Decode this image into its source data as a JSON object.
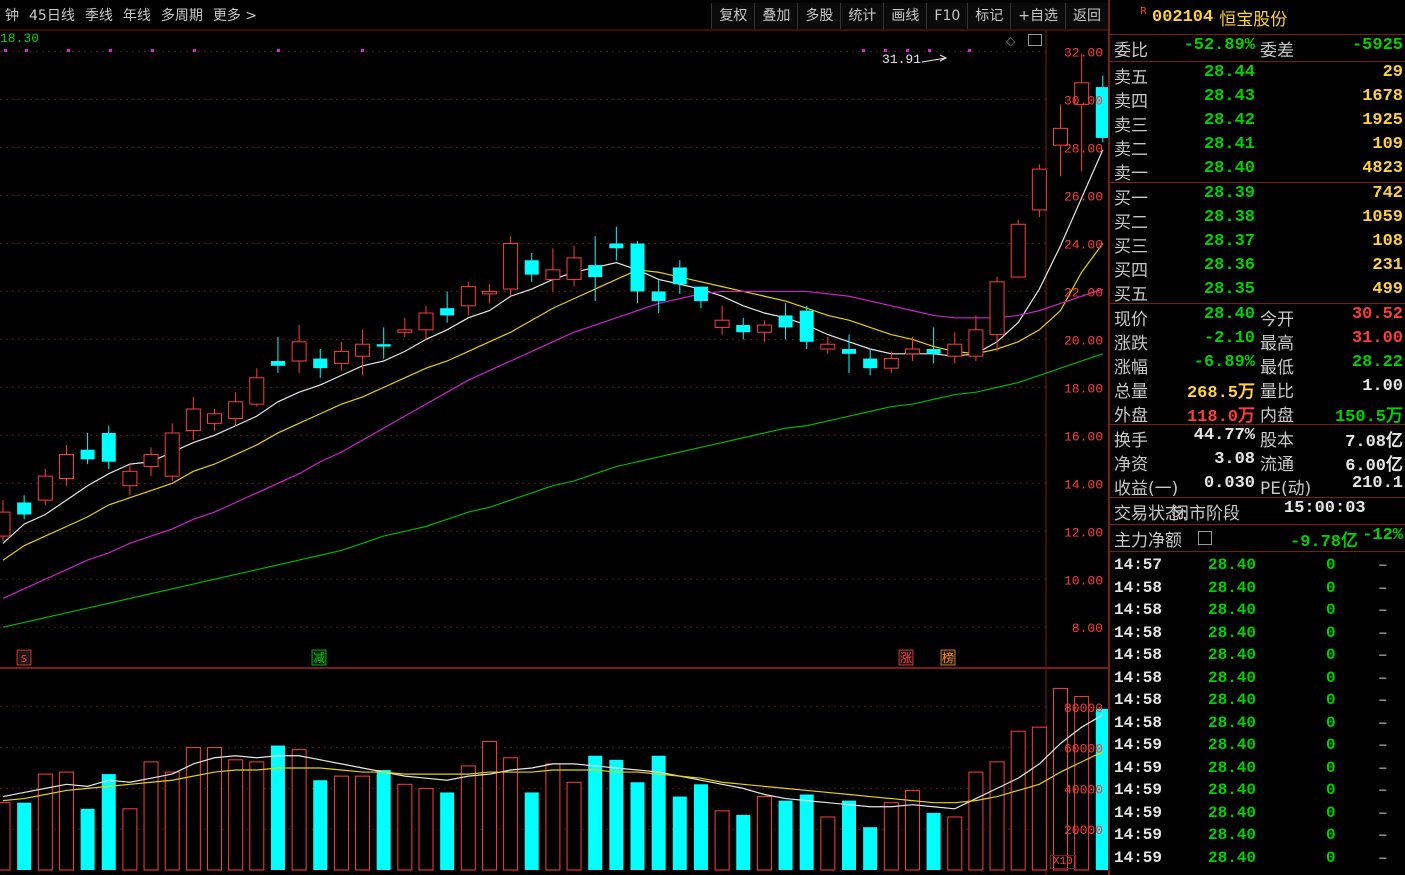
{
  "toolbar": {
    "left": [
      "钟",
      "45日线",
      "季线",
      "年线",
      "多周期",
      "更多 >"
    ],
    "right": [
      "复权",
      "叠加",
      "多股",
      "统计",
      "画线",
      "F10",
      "标记",
      "+自选",
      "返回"
    ]
  },
  "chart": {
    "prev_close_label": "18.30",
    "high_marker": "31.91",
    "price_axis": [
      "32.00",
      "30.00",
      "28.00",
      "26.00",
      "24.00",
      "22.00",
      "20.00",
      "18.00",
      "16.00",
      "14.00",
      "12.00",
      "10.00",
      "8.00"
    ],
    "volume_axis": [
      "80000",
      "60000",
      "40000",
      "20000"
    ],
    "volume_unit": "X10",
    "event_tags": [
      {
        "text": "s",
        "color": "#ff3c3c"
      },
      {
        "text": "减",
        "color": "#00d200"
      },
      {
        "text": "涨",
        "color": "#ff3c3c"
      },
      {
        "text": "榜",
        "color": "#ff8c1a"
      }
    ]
  },
  "chart_data": {
    "type": "candlestick",
    "ylim": [
      6.3,
      32.9
    ],
    "candles": [
      [
        11.8,
        12.8,
        13.3,
        11.6
      ],
      [
        13.2,
        12.7,
        13.5,
        12.5
      ],
      [
        13.3,
        14.3,
        14.6,
        13.1
      ],
      [
        14.2,
        15.2,
        15.6,
        13.9
      ],
      [
        15.4,
        15.0,
        16.1,
        14.8
      ],
      [
        16.1,
        14.9,
        16.4,
        14.6
      ],
      [
        13.9,
        14.5,
        14.8,
        13.5
      ],
      [
        14.7,
        15.2,
        15.5,
        14.3
      ],
      [
        14.3,
        16.1,
        16.5,
        14.1
      ],
      [
        16.2,
        17.1,
        17.6,
        15.8
      ],
      [
        16.5,
        16.9,
        17.1,
        16.2
      ],
      [
        16.7,
        17.4,
        17.8,
        16.4
      ],
      [
        17.3,
        18.4,
        18.8,
        17.2
      ],
      [
        19.1,
        18.9,
        20.1,
        18.6
      ],
      [
        19.1,
        19.9,
        20.6,
        18.6
      ],
      [
        19.2,
        18.8,
        19.6,
        18.4
      ],
      [
        19.0,
        19.5,
        19.9,
        18.7
      ],
      [
        19.3,
        19.8,
        20.4,
        18.5
      ],
      [
        19.8,
        19.7,
        20.5,
        19.2
      ],
      [
        20.3,
        20.4,
        20.9,
        20.1
      ],
      [
        20.4,
        21.1,
        21.4,
        20.0
      ],
      [
        21.3,
        21.0,
        22.0,
        20.7
      ],
      [
        21.4,
        22.2,
        22.4,
        21.0
      ],
      [
        21.9,
        22.0,
        22.3,
        21.5
      ],
      [
        22.1,
        24.0,
        24.3,
        21.8
      ],
      [
        23.3,
        22.7,
        23.6,
        22.4
      ],
      [
        22.5,
        22.9,
        23.8,
        22.0
      ],
      [
        22.5,
        23.4,
        23.9,
        22.2
      ],
      [
        23.1,
        22.6,
        24.3,
        21.6
      ],
      [
        24.0,
        23.8,
        24.7,
        23.3
      ],
      [
        24.0,
        22.0,
        24.1,
        21.5
      ],
      [
        22.0,
        21.6,
        22.5,
        21.1
      ],
      [
        23.0,
        22.3,
        23.3,
        21.9
      ],
      [
        22.2,
        21.6,
        22.2,
        21.3
      ],
      [
        20.5,
        20.8,
        21.4,
        20.2
      ],
      [
        20.6,
        20.3,
        20.9,
        20.0
      ],
      [
        20.3,
        20.6,
        20.8,
        19.9
      ],
      [
        21.0,
        20.5,
        21.5,
        20.0
      ],
      [
        21.2,
        19.9,
        21.4,
        19.6
      ],
      [
        19.6,
        19.8,
        20.1,
        19.4
      ],
      [
        19.6,
        19.4,
        20.2,
        18.6
      ],
      [
        19.2,
        18.8,
        19.6,
        18.5
      ],
      [
        18.8,
        19.2,
        19.5,
        18.6
      ],
      [
        19.4,
        19.6,
        20.1,
        19.1
      ],
      [
        19.6,
        19.4,
        20.5,
        19.0
      ],
      [
        19.3,
        19.8,
        20.3,
        19.0
      ],
      [
        19.3,
        20.4,
        21.0,
        19.1
      ],
      [
        20.2,
        22.4,
        22.6,
        19.5
      ],
      [
        22.6,
        24.8,
        25.0,
        22.6
      ],
      [
        25.4,
        27.1,
        27.3,
        25.1
      ],
      [
        28.1,
        28.8,
        29.8,
        26.8
      ],
      [
        29.8,
        30.7,
        31.91,
        27.0
      ],
      [
        30.52,
        28.4,
        31.0,
        28.22
      ]
    ],
    "ma_white": [
      11.5,
      12.3,
      12.7,
      13.3,
      13.9,
      14.4,
      14.8,
      14.9,
      15.3,
      15.7,
      16.0,
      16.4,
      16.8,
      17.4,
      17.8,
      18.1,
      18.5,
      18.9,
      19.1,
      19.5,
      20.0,
      20.4,
      20.9,
      21.2,
      21.8,
      22.1,
      22.5,
      22.8,
      23.0,
      23.2,
      22.9,
      22.5,
      22.3,
      22.1,
      21.8,
      21.4,
      21.1,
      20.9,
      20.6,
      20.2,
      19.9,
      19.6,
      19.4,
      19.4,
      19.4,
      19.3,
      19.4,
      19.9,
      20.7,
      22.1,
      23.9,
      25.9,
      27.9
    ],
    "ma_yellow": [
      10.8,
      11.4,
      11.8,
      12.2,
      12.6,
      13.1,
      13.4,
      13.7,
      14.0,
      14.5,
      14.8,
      15.2,
      15.6,
      16.1,
      16.5,
      16.9,
      17.3,
      17.6,
      18.0,
      18.4,
      18.8,
      19.1,
      19.5,
      19.9,
      20.3,
      20.8,
      21.3,
      21.7,
      22.1,
      22.5,
      22.9,
      22.8,
      22.6,
      22.4,
      22.2,
      22.0,
      21.8,
      21.6,
      21.3,
      21.0,
      20.8,
      20.5,
      20.2,
      20.0,
      19.7,
      19.5,
      19.4,
      19.6,
      19.9,
      20.4,
      21.2,
      22.8,
      24.0
    ],
    "ma_magenta": [
      9.2,
      9.6,
      10.0,
      10.4,
      10.8,
      11.1,
      11.5,
      11.8,
      12.1,
      12.5,
      12.8,
      13.2,
      13.6,
      14.0,
      14.4,
      14.9,
      15.3,
      15.8,
      16.3,
      16.8,
      17.3,
      17.8,
      18.3,
      18.7,
      19.1,
      19.5,
      19.9,
      20.3,
      20.6,
      20.9,
      21.2,
      21.5,
      21.7,
      21.9,
      22.0,
      22.0,
      22.0,
      22.0,
      22.0,
      21.9,
      21.8,
      21.6,
      21.4,
      21.2,
      21.0,
      20.9,
      20.9,
      20.9,
      21.0,
      21.2,
      21.5,
      21.8,
      22.1
    ],
    "ma_green": [
      8.0,
      8.2,
      8.4,
      8.6,
      8.8,
      9.0,
      9.2,
      9.4,
      9.6,
      9.8,
      10.0,
      10.2,
      10.4,
      10.6,
      10.8,
      11.0,
      11.2,
      11.5,
      11.8,
      12.0,
      12.2,
      12.5,
      12.8,
      13.0,
      13.3,
      13.6,
      13.9,
      14.1,
      14.4,
      14.7,
      14.9,
      15.1,
      15.3,
      15.5,
      15.7,
      15.9,
      16.1,
      16.3,
      16.4,
      16.6,
      16.8,
      17.0,
      17.2,
      17.3,
      17.5,
      17.7,
      17.8,
      18.0,
      18.2,
      18.5,
      18.8,
      19.1,
      19.4
    ],
    "volume_ylim": [
      0,
      99000
    ],
    "volume": [
      33000,
      33000,
      47000,
      48000,
      30000,
      47000,
      30000,
      53000,
      48000,
      60000,
      60000,
      54000,
      53000,
      61000,
      59000,
      44000,
      46000,
      46000,
      49000,
      42000,
      40000,
      38000,
      51000,
      63000,
      55000,
      38000,
      52000,
      43000,
      56000,
      54000,
      43000,
      56000,
      36000,
      42000,
      29000,
      27000,
      36000,
      34000,
      37000,
      26000,
      34000,
      21000,
      33000,
      39000,
      28000,
      26000,
      48000,
      53000,
      68000,
      70000,
      89000,
      85000,
      79000
    ],
    "vol_ma_white": [
      36000,
      38000,
      40000,
      42000,
      41000,
      44000,
      43000,
      45000,
      47000,
      52000,
      55000,
      56000,
      55000,
      56000,
      56000,
      54000,
      52000,
      50000,
      48000,
      46000,
      45000,
      44000,
      46000,
      47000,
      49000,
      50000,
      52000,
      52000,
      51000,
      50000,
      49000,
      48000,
      46000,
      44000,
      42000,
      40000,
      37000,
      35000,
      34000,
      33000,
      32000,
      31000,
      31000,
      32000,
      31000,
      30000,
      35000,
      40000,
      45000,
      52000,
      62000,
      70000,
      76000
    ],
    "vol_ma_yellow": [
      34000,
      35000,
      37000,
      39000,
      40000,
      41000,
      42000,
      43000,
      44000,
      46000,
      48000,
      49000,
      49000,
      50000,
      50000,
      50000,
      49000,
      48000,
      48000,
      47000,
      47000,
      47000,
      47000,
      48000,
      48000,
      48000,
      49000,
      49000,
      49000,
      48000,
      48000,
      47000,
      46000,
      45000,
      43000,
      42000,
      41000,
      40000,
      39000,
      38000,
      37000,
      36000,
      35000,
      34000,
      33000,
      33000,
      34000,
      36000,
      39000,
      42000,
      48000,
      53000,
      58000
    ]
  },
  "panel": {
    "code": "002104",
    "name": "恒宝股份",
    "badge": "R",
    "weibi": {
      "label": "委比",
      "value": "-52.89%",
      "label2": "委差",
      "value2": "-5925"
    },
    "asks": [
      {
        "label": "卖五",
        "price": "28.44",
        "vol": "29"
      },
      {
        "label": "卖四",
        "price": "28.43",
        "vol": "1678"
      },
      {
        "label": "卖三",
        "price": "28.42",
        "vol": "1925"
      },
      {
        "label": "卖二",
        "price": "28.41",
        "vol": "109"
      },
      {
        "label": "卖一",
        "price": "28.40",
        "vol": "4823"
      }
    ],
    "bids": [
      {
        "label": "买一",
        "price": "28.39",
        "vol": "742"
      },
      {
        "label": "买二",
        "price": "28.38",
        "vol": "1059"
      },
      {
        "label": "买三",
        "price": "28.37",
        "vol": "108"
      },
      {
        "label": "买四",
        "price": "28.36",
        "vol": "231"
      },
      {
        "label": "买五",
        "price": "28.35",
        "vol": "499"
      }
    ],
    "stats1": [
      {
        "l1": "现价",
        "v1": "28.40",
        "c1": "green",
        "l2": "今开",
        "v2": "30.52",
        "c2": "red"
      },
      {
        "l1": "涨跌",
        "v1": "-2.10",
        "c1": "green",
        "l2": "最高",
        "v2": "31.00",
        "c2": "red"
      },
      {
        "l1": "涨幅",
        "v1": "-6.89%",
        "c1": "green",
        "l2": "最低",
        "v2": "28.22",
        "c2": "green"
      },
      {
        "l1": "总量",
        "v1": "268.5万",
        "c1": "yellow",
        "l2": "量比",
        "v2": "1.00",
        "c2": "white"
      },
      {
        "l1": "外盘",
        "v1": "118.0万",
        "c1": "red",
        "l2": "内盘",
        "v2": "150.5万",
        "c2": "green"
      }
    ],
    "stats2": [
      {
        "l1": "换手",
        "v1": "44.77%",
        "c1": "white",
        "l2": "股本",
        "v2": "7.08亿",
        "c2": "white"
      },
      {
        "l1": "净资",
        "v1": "3.08",
        "c1": "white",
        "l2": "流通",
        "v2": "6.00亿",
        "c2": "white"
      },
      {
        "l1": "收益(一)",
        "v1": "0.030",
        "c1": "white",
        "l2": "PE(动)",
        "v2": "210.1",
        "c2": "white"
      }
    ],
    "trade_status": {
      "label": "交易状态:",
      "value": "闭市阶段",
      "time": "15:00:03"
    },
    "main_flow": {
      "label": "主力净额",
      "value": "-9.78亿",
      "pct": "-12%"
    },
    "ticks": [
      {
        "t": "14:57",
        "p": "28.40",
        "q": "0",
        "f": "–"
      },
      {
        "t": "14:58",
        "p": "28.40",
        "q": "0",
        "f": "–"
      },
      {
        "t": "14:58",
        "p": "28.40",
        "q": "0",
        "f": "–"
      },
      {
        "t": "14:58",
        "p": "28.40",
        "q": "0",
        "f": "–"
      },
      {
        "t": "14:58",
        "p": "28.40",
        "q": "0",
        "f": "–"
      },
      {
        "t": "14:58",
        "p": "28.40",
        "q": "0",
        "f": "–"
      },
      {
        "t": "14:58",
        "p": "28.40",
        "q": "0",
        "f": "–"
      },
      {
        "t": "14:58",
        "p": "28.40",
        "q": "0",
        "f": "–"
      },
      {
        "t": "14:59",
        "p": "28.40",
        "q": "0",
        "f": "–"
      },
      {
        "t": "14:59",
        "p": "28.40",
        "q": "0",
        "f": "–"
      },
      {
        "t": "14:59",
        "p": "28.40",
        "q": "0",
        "f": "–"
      },
      {
        "t": "14:59",
        "p": "28.40",
        "q": "0",
        "f": "–"
      },
      {
        "t": "14:59",
        "p": "28.40",
        "q": "0",
        "f": "–"
      },
      {
        "t": "14:59",
        "p": "28.40",
        "q": "0",
        "f": "–"
      }
    ]
  }
}
